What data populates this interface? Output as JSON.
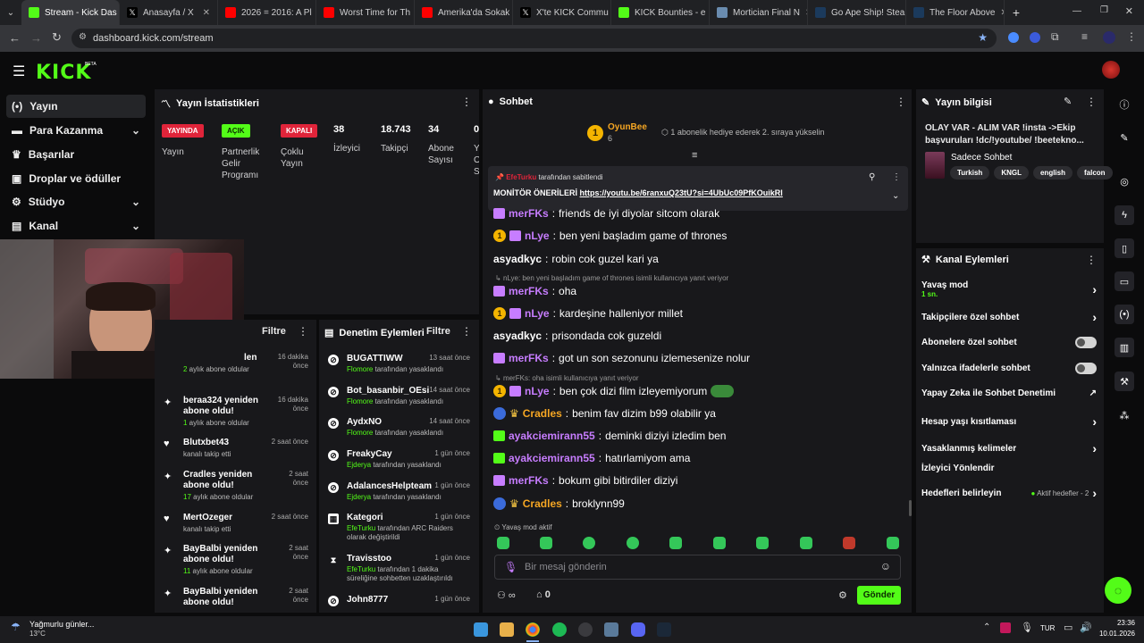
{
  "browser": {
    "tabs": [
      {
        "title": "Stream - Kick Das",
        "color": "#53fc18",
        "active": true
      },
      {
        "title": "Anasayfa / X",
        "color": "#222222"
      },
      {
        "title": "2026 = 2016: A Pl",
        "color": "#ff0000"
      },
      {
        "title": "Worst Time for Th",
        "color": "#ff0000"
      },
      {
        "title": "Amerika'da Sokak",
        "color": "#ff0000"
      },
      {
        "title": "X'te KICK Commu",
        "color": "#222222"
      },
      {
        "title": "KICK Bounties - e",
        "color": "#53fc18"
      },
      {
        "title": "Mortician Final N",
        "color": "#6a8caf"
      },
      {
        "title": "Go Ape Ship! Stea",
        "color": "#1b3a5c"
      },
      {
        "title": "The Floor Above",
        "color": "#1b3a5c"
      }
    ],
    "new_tab": "+",
    "url": "dashboard.kick.com/stream"
  },
  "header": {
    "logo": "KICK",
    "beta": "BETA"
  },
  "sidebar": {
    "items": [
      {
        "label": "Yayın",
        "icon": "broadcast-icon"
      },
      {
        "label": "Para Kazanma",
        "icon": "money-icon"
      },
      {
        "label": "Başarılar",
        "icon": "trophy-icon"
      },
      {
        "label": "Droplar ve ödüller",
        "icon": "gift-icon"
      },
      {
        "label": "Stüdyo",
        "icon": "studio-icon"
      },
      {
        "label": "Kanal",
        "icon": "channel-icon"
      }
    ]
  },
  "stats": {
    "title": "Yayın İstatistikleri",
    "badges": [
      {
        "label": "YAYINDA",
        "caption": "Yayın",
        "color": "#e0243a"
      },
      {
        "label": "AÇIK",
        "caption": "Partnerlik Gelir Programı",
        "color": "#53fc18"
      },
      {
        "label": "KAPALI",
        "caption": "Çoklu Yayın",
        "color": "#e0243a"
      }
    ],
    "numbers": [
      {
        "value": "38",
        "caption": "İzleyici"
      },
      {
        "value": "18.743",
        "caption": "Takipçi"
      },
      {
        "value": "34",
        "caption": "Abone Sayısı"
      },
      {
        "value": "0",
        "caption": "Y O S"
      }
    ]
  },
  "events": {
    "filter": "Filtre",
    "items": [
      {
        "title": "len",
        "sub_hl": "2",
        "sub": " aylık abone oldular",
        "time": "16 dakika önce",
        "icon": "star-icon"
      },
      {
        "title": "beraa324 yeniden abone oldu!",
        "sub_hl": "1",
        "sub": " aylık abone oldular",
        "time": "16 dakika önce",
        "icon": "star-icon"
      },
      {
        "title": "Blutxbet43",
        "sub_hl": "",
        "sub": "kanalı takip etti",
        "time": "2 saat önce",
        "icon": "heart-icon"
      },
      {
        "title": "Cradles yeniden abone oldu!",
        "sub_hl": "17",
        "sub": " aylık abone oldular",
        "time": "2 saat önce",
        "icon": "star-icon"
      },
      {
        "title": "MertOzeger",
        "sub_hl": "",
        "sub": "kanalı takip etti",
        "time": "2 saat önce",
        "icon": "heart-icon"
      },
      {
        "title": "BayBalbi yeniden abone oldu!",
        "sub_hl": "11",
        "sub": " aylık abone oldular",
        "time": "2 saat önce",
        "icon": "star-icon"
      },
      {
        "title": "BayBalbi yeniden abone oldu!",
        "sub_hl": "",
        "sub": "",
        "time": "2 saat önce",
        "icon": "star-icon"
      }
    ]
  },
  "moderation": {
    "title": "Denetim Eylemleri",
    "filter": "Filtre",
    "items": [
      {
        "title": "BUGATTIWW",
        "actor": "Flomore",
        "action": " tarafından yasaklandı",
        "time": "13 saat önce",
        "icon": "ban-icon"
      },
      {
        "title": "Bot_basanbir_OEsin",
        "actor": "Flomore",
        "action": " tarafından yasaklandı",
        "time": "14 saat önce",
        "icon": "ban-icon"
      },
      {
        "title": "AydxNO",
        "actor": "Flomore",
        "action": " tarafından yasaklandı",
        "time": "14 saat önce",
        "icon": "ban-icon"
      },
      {
        "title": "FreakyCay",
        "actor": "Ejderya",
        "action": " tarafından yasaklandı",
        "time": "1 gün önce",
        "icon": "ban-icon"
      },
      {
        "title": "AdalancesHelpteam",
        "actor": "Ejderya",
        "action": " tarafından yasaklandı",
        "time": "1 gün önce",
        "icon": "ban-icon"
      },
      {
        "title": "Kategori",
        "actor": "EfeTurku",
        "action": " tarafından ARC Raiders olarak değiştirildi",
        "time": "1 gün önce",
        "icon": "category-icon"
      },
      {
        "title": "Travisstoo",
        "actor": "EfeTurku",
        "action": " tarafından 1 dakika süreliğine sohbetten uzaklaştırıldı",
        "time": "1 gün önce",
        "icon": "hourglass-icon"
      },
      {
        "title": "John8777",
        "actor": "",
        "action": "",
        "time": "1 gün önce",
        "icon": "ban-icon"
      }
    ]
  },
  "chat": {
    "title": "Sohbet",
    "top_user": "OyunBee",
    "top_rank": "1",
    "top_count": "6",
    "goal_text": "1 abonelik hediye ederek 2. sıraya yükselin",
    "pinned_by": "EfeTurku",
    "pinned_suffix": "tarafından sabitlendi",
    "pinned_label": "MONİTÖR ÖNERİLERİ",
    "pinned_link": "https://youtu.be/6ranxuQ23tU?si=4UbUc09PfKOuikRl",
    "messages": [
      {
        "user": "merFKs",
        "color": "#c77dff",
        "text": "friends de iyi diyolar sitcom olarak",
        "badges": "gift",
        "reply": ""
      },
      {
        "user": "nLye",
        "color": "#c77dff",
        "text": "ben yeni başladım game of thrones",
        "badges": "coin gift",
        "reply": ""
      },
      {
        "user": "asyadkyc",
        "color": "#e9e9ea",
        "text": "robin cok guzel kari ya",
        "badges": "",
        "reply": ""
      },
      {
        "user": "merFKs",
        "color": "#c77dff",
        "text": "oha",
        "badges": "gift",
        "reply": "nLye: ben yeni başladım game of thrones isimli kullanıcıya yanıt veriyor"
      },
      {
        "user": "nLye",
        "color": "#c77dff",
        "text": "kardeşine halleniyor millet",
        "badges": "coin gift",
        "reply": ""
      },
      {
        "user": "asyadkyc",
        "color": "#e9e9ea",
        "text": "prisondada cok guzeldi",
        "badges": "",
        "reply": ""
      },
      {
        "user": "merFKs",
        "color": "#c77dff",
        "text": "got un son sezonunu izlemesenize nolur",
        "badges": "gift",
        "reply": ""
      },
      {
        "user": "nLye",
        "color": "#c77dff",
        "text": "ben çok dizi film izleyemiyorum",
        "badges": "coin gift",
        "reply": "merFKs: oha isimli kullanıcıya yanıt veriyor"
      },
      {
        "user": "Cradles",
        "color": "#f5a623",
        "text": "benim fav dizim b99 olabilir ya",
        "badges": "globe crown",
        "reply": ""
      },
      {
        "user": "ayakciemirann55",
        "color": "#c77dff",
        "text": "deminki diziyi izledim ben",
        "badges": "gift",
        "reply": ""
      },
      {
        "user": "ayakciemirann55",
        "color": "#c77dff",
        "text": "hatırlamiyom ama",
        "badges": "gift",
        "reply": ""
      },
      {
        "user": "merFKs",
        "color": "#c77dff",
        "text": "bokum gibi bitirdiler diziyi",
        "badges": "gift",
        "reply": ""
      },
      {
        "user": "Cradles",
        "color": "#f5a623",
        "text": "broklynn99",
        "badges": "globe crown",
        "reply": ""
      }
    ],
    "slow_mode": "Yavaş mod aktif",
    "placeholder": "Bir mesaj gönderin",
    "points": "0",
    "send": "Gönder"
  },
  "stream_info": {
    "title": "Yayın bilgisi",
    "stream_title": "OLAY VAR - ALIM VAR !insta ->Ekip başvuruları !dc/!youtube/ !beetekno...",
    "category": "Sadece Sohbet",
    "tags": [
      "Turkish",
      "KNGL",
      "english",
      "falcon"
    ]
  },
  "channel_actions": {
    "title": "Kanal Eylemleri",
    "items": [
      {
        "label": "Yavaş mod",
        "sub": "1 sn.",
        "control": "chevron"
      },
      {
        "label": "Takipçilere özel sohbet",
        "sub": "",
        "control": "chevron"
      },
      {
        "label": "Abonelere özel sohbet",
        "sub": "",
        "control": "toggle"
      },
      {
        "label": "Yalnızca ifadelerle sohbet",
        "sub": "",
        "control": "toggle"
      },
      {
        "label": "Yapay Zeka ile Sohbet Denetimi",
        "sub": "",
        "control": "external"
      },
      {
        "label": "Hesap yaşı kısıtlaması",
        "sub": "",
        "control": "chevron"
      },
      {
        "label": "Yasaklanmış kelimeler",
        "sub": "",
        "control": "chevron"
      },
      {
        "label": "İzleyici Yönlendir",
        "sub": "",
        "control": "none"
      },
      {
        "label": "Hedefleri belirleyin",
        "sub": "",
        "control": "goals"
      }
    ],
    "goals_status": "Aktif hedefler - 2"
  },
  "taskbar": {
    "weather": "Yağmurlu günler...",
    "temp": "13°C",
    "lang": "TUR",
    "time": "23:36",
    "date": "10.01.2026"
  }
}
